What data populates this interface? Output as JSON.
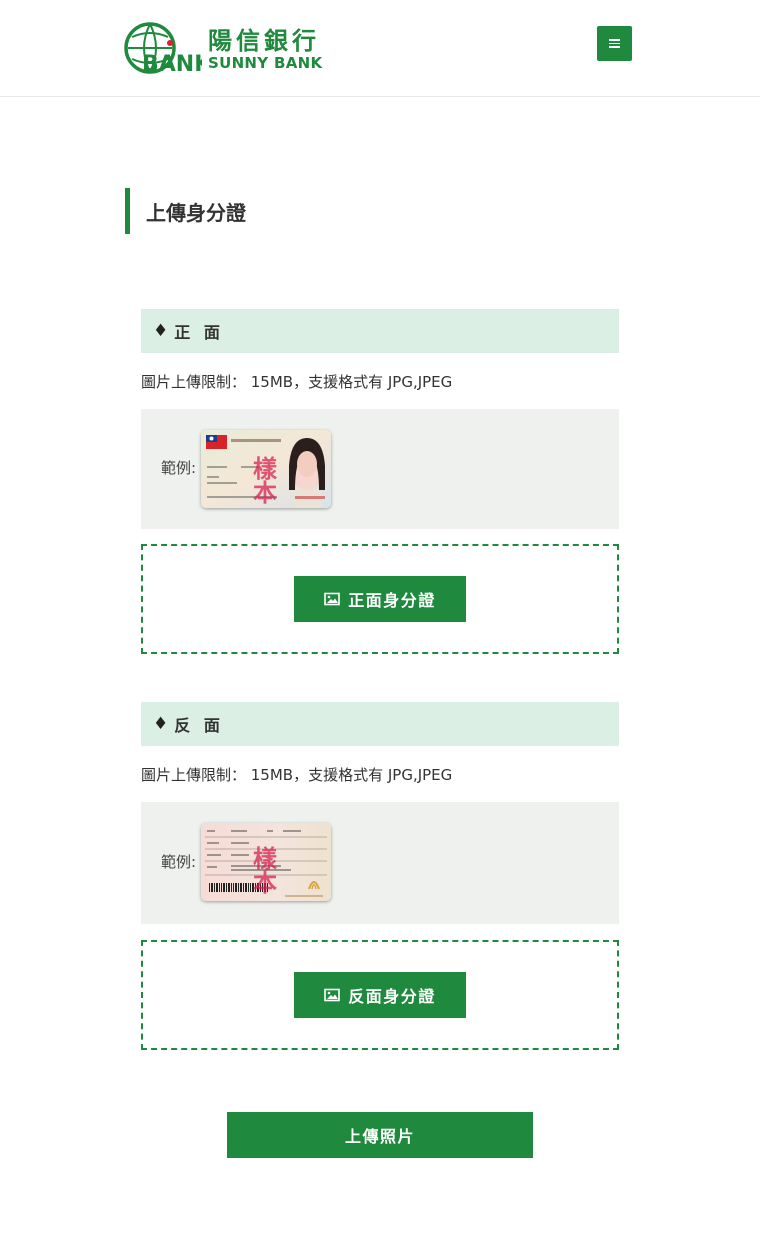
{
  "brand": {
    "name_zh": "陽信銀行",
    "name_en": "SUNNY BANK",
    "emblem_text": "SUNNY",
    "emblem_bank": "BANK",
    "color": "#1f8a3e"
  },
  "header": {
    "menu_icon": "hamburger-icon"
  },
  "page": {
    "title": "上傳身分證"
  },
  "sections": [
    {
      "heading_icon": "♦",
      "heading": "正 面",
      "limit_text": "圖片上傳限制： 15MB，支援格式有 JPG,JPEG",
      "example_label": "範例:",
      "sample_stamp": "樣本",
      "upload_icon": "image-icon",
      "upload_label": "正面身分證"
    },
    {
      "heading_icon": "♦",
      "heading": "反 面",
      "limit_text": "圖片上傳限制： 15MB，支援格式有 JPG,JPEG",
      "example_label": "範例:",
      "sample_stamp": "樣本",
      "upload_icon": "image-icon",
      "upload_label": "反面身分證"
    }
  ],
  "submit": {
    "label": "上傳照片"
  },
  "colors": {
    "primary": "#1f8a3e",
    "section_bg": "#dcefe5",
    "example_bg": "#eef1ee"
  }
}
